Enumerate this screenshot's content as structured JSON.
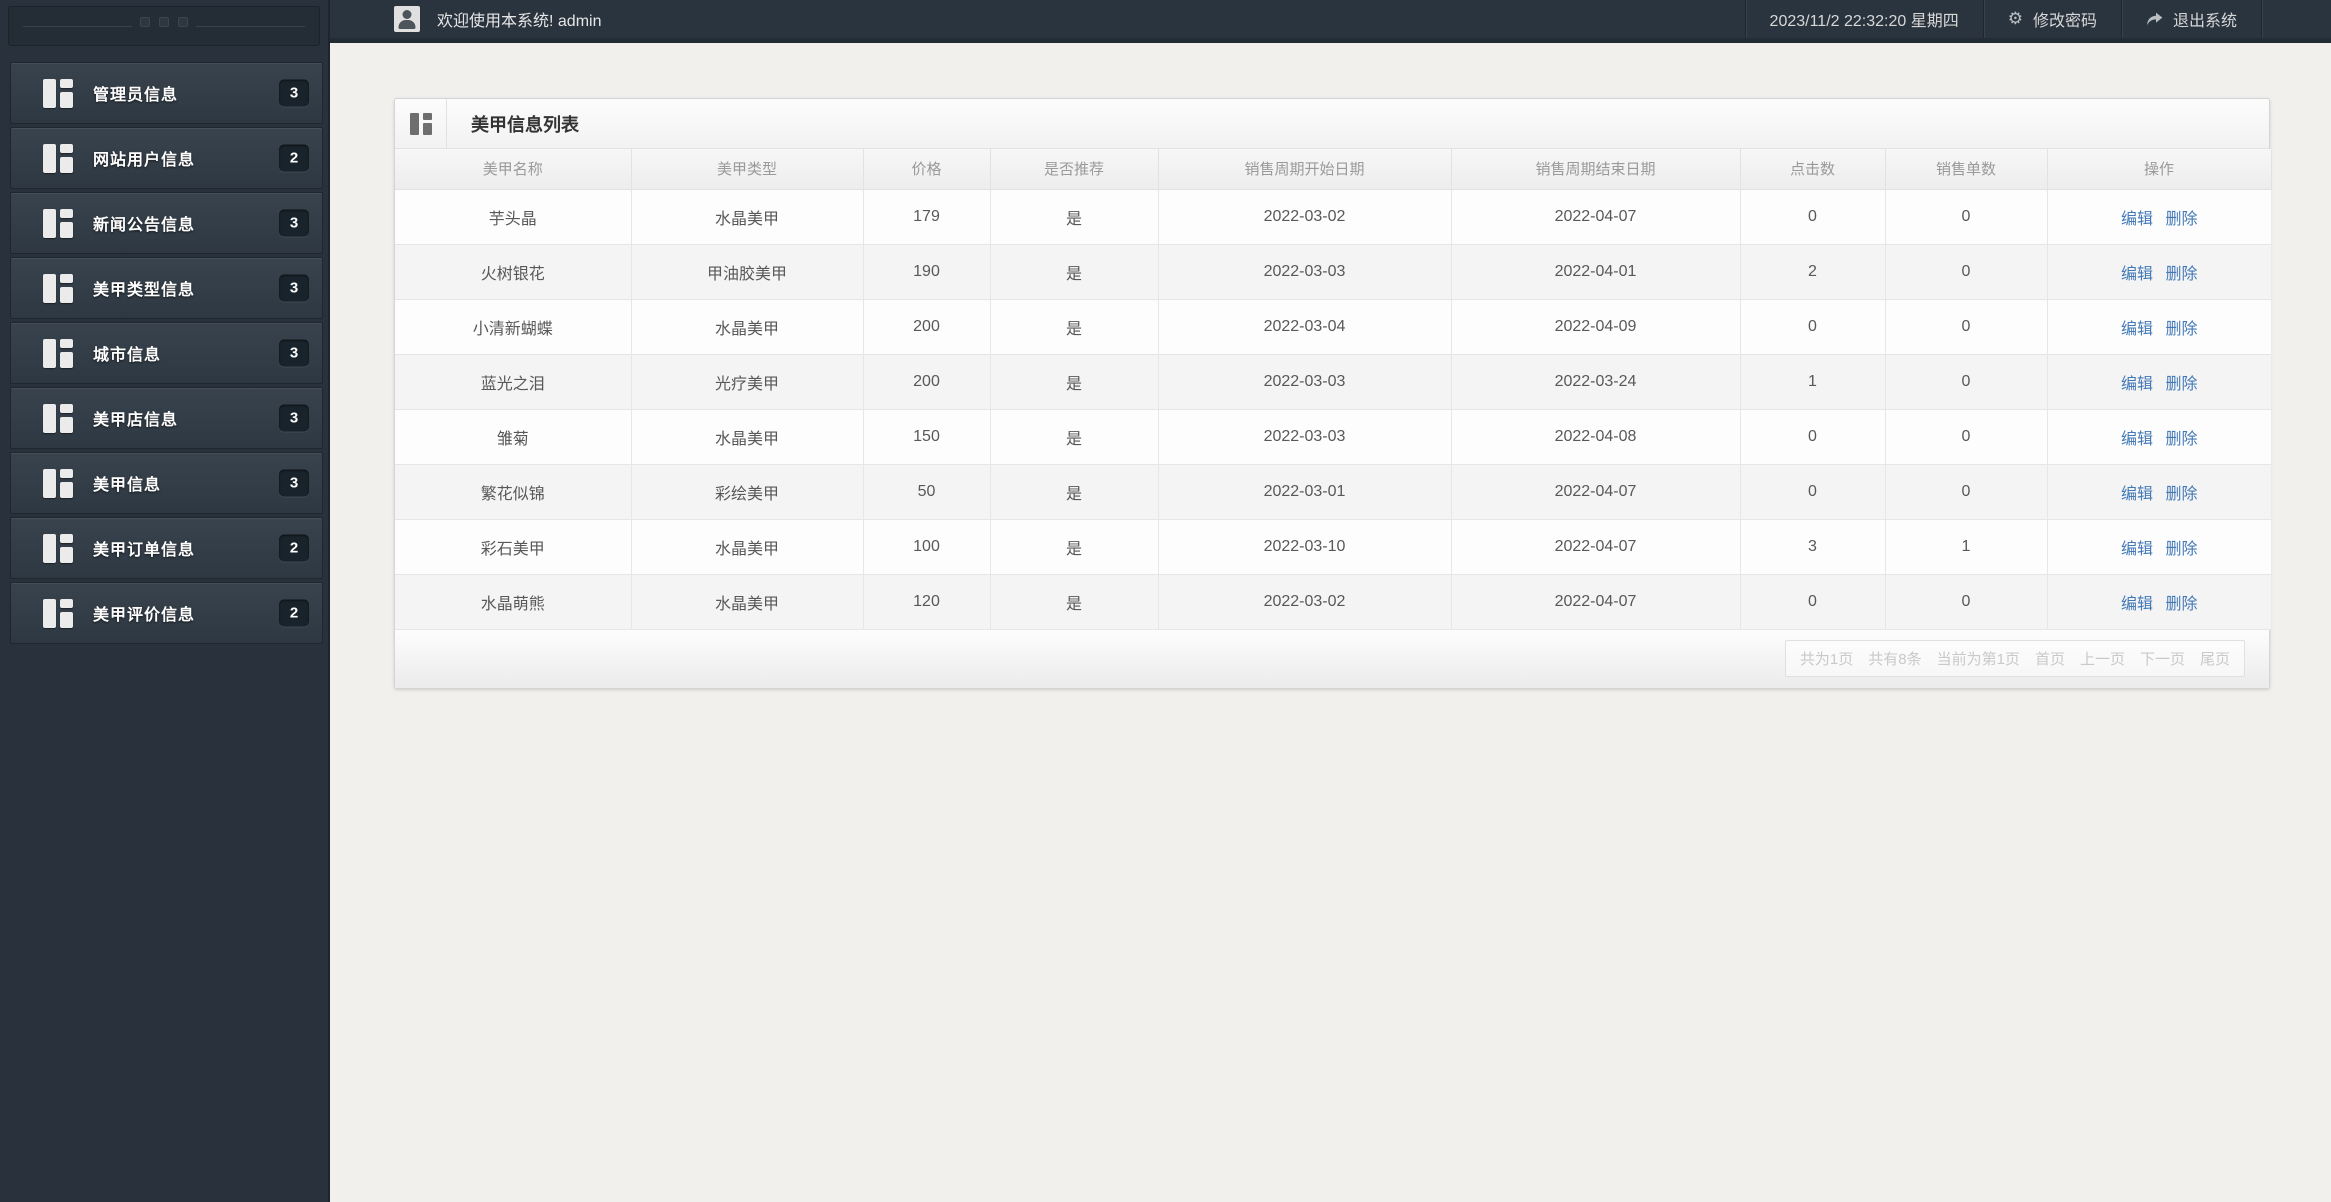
{
  "header": {
    "welcome": "欢迎使用本系统! admin",
    "datetime": "2023/11/2 22:32:20 星期四",
    "change_password": "修改密码",
    "logout": "退出系统",
    "gear_glyph": "⚙"
  },
  "sidebar": {
    "items": [
      {
        "label": "管理员信息",
        "count": "3"
      },
      {
        "label": "网站用户信息",
        "count": "2"
      },
      {
        "label": "新闻公告信息",
        "count": "3"
      },
      {
        "label": "美甲类型信息",
        "count": "3"
      },
      {
        "label": "城市信息",
        "count": "3"
      },
      {
        "label": "美甲店信息",
        "count": "3"
      },
      {
        "label": "美甲信息",
        "count": "3"
      },
      {
        "label": "美甲订单信息",
        "count": "2"
      },
      {
        "label": "美甲评价信息",
        "count": "2"
      }
    ]
  },
  "panel": {
    "title": "美甲信息列表"
  },
  "table": {
    "columns": [
      "美甲名称",
      "美甲类型",
      "价格",
      "是否推荐",
      "销售周期开始日期",
      "销售周期结束日期",
      "点击数",
      "销售单数",
      "操作"
    ],
    "action_edit": "编辑",
    "action_delete": "删除",
    "rows": [
      {
        "name": "芋头晶",
        "type": "水晶美甲",
        "price": "179",
        "recommended": "是",
        "start": "2022-03-02",
        "end": "2022-04-07",
        "clicks": "0",
        "orders": "0"
      },
      {
        "name": "火树银花",
        "type": "甲油胶美甲",
        "price": "190",
        "recommended": "是",
        "start": "2022-03-03",
        "end": "2022-04-01",
        "clicks": "2",
        "orders": "0"
      },
      {
        "name": "小清新蝴蝶",
        "type": "水晶美甲",
        "price": "200",
        "recommended": "是",
        "start": "2022-03-04",
        "end": "2022-04-09",
        "clicks": "0",
        "orders": "0"
      },
      {
        "name": "蓝光之泪",
        "type": "光疗美甲",
        "price": "200",
        "recommended": "是",
        "start": "2022-03-03",
        "end": "2022-03-24",
        "clicks": "1",
        "orders": "0"
      },
      {
        "name": "雏菊",
        "type": "水晶美甲",
        "price": "150",
        "recommended": "是",
        "start": "2022-03-03",
        "end": "2022-04-08",
        "clicks": "0",
        "orders": "0"
      },
      {
        "name": "繁花似锦",
        "type": "彩绘美甲",
        "price": "50",
        "recommended": "是",
        "start": "2022-03-01",
        "end": "2022-04-07",
        "clicks": "0",
        "orders": "0"
      },
      {
        "name": "彩石美甲",
        "type": "水晶美甲",
        "price": "100",
        "recommended": "是",
        "start": "2022-03-10",
        "end": "2022-04-07",
        "clicks": "3",
        "orders": "1"
      },
      {
        "name": "水晶萌熊",
        "type": "水晶美甲",
        "price": "120",
        "recommended": "是",
        "start": "2022-03-02",
        "end": "2022-04-07",
        "clicks": "0",
        "orders": "0"
      }
    ]
  },
  "pagination": {
    "total_pages": "共为1页",
    "total_items": "共有8条",
    "current_page": "当前为第1页",
    "first": "首页",
    "prev": "上一页",
    "next": "下一页",
    "last": "尾页"
  }
}
